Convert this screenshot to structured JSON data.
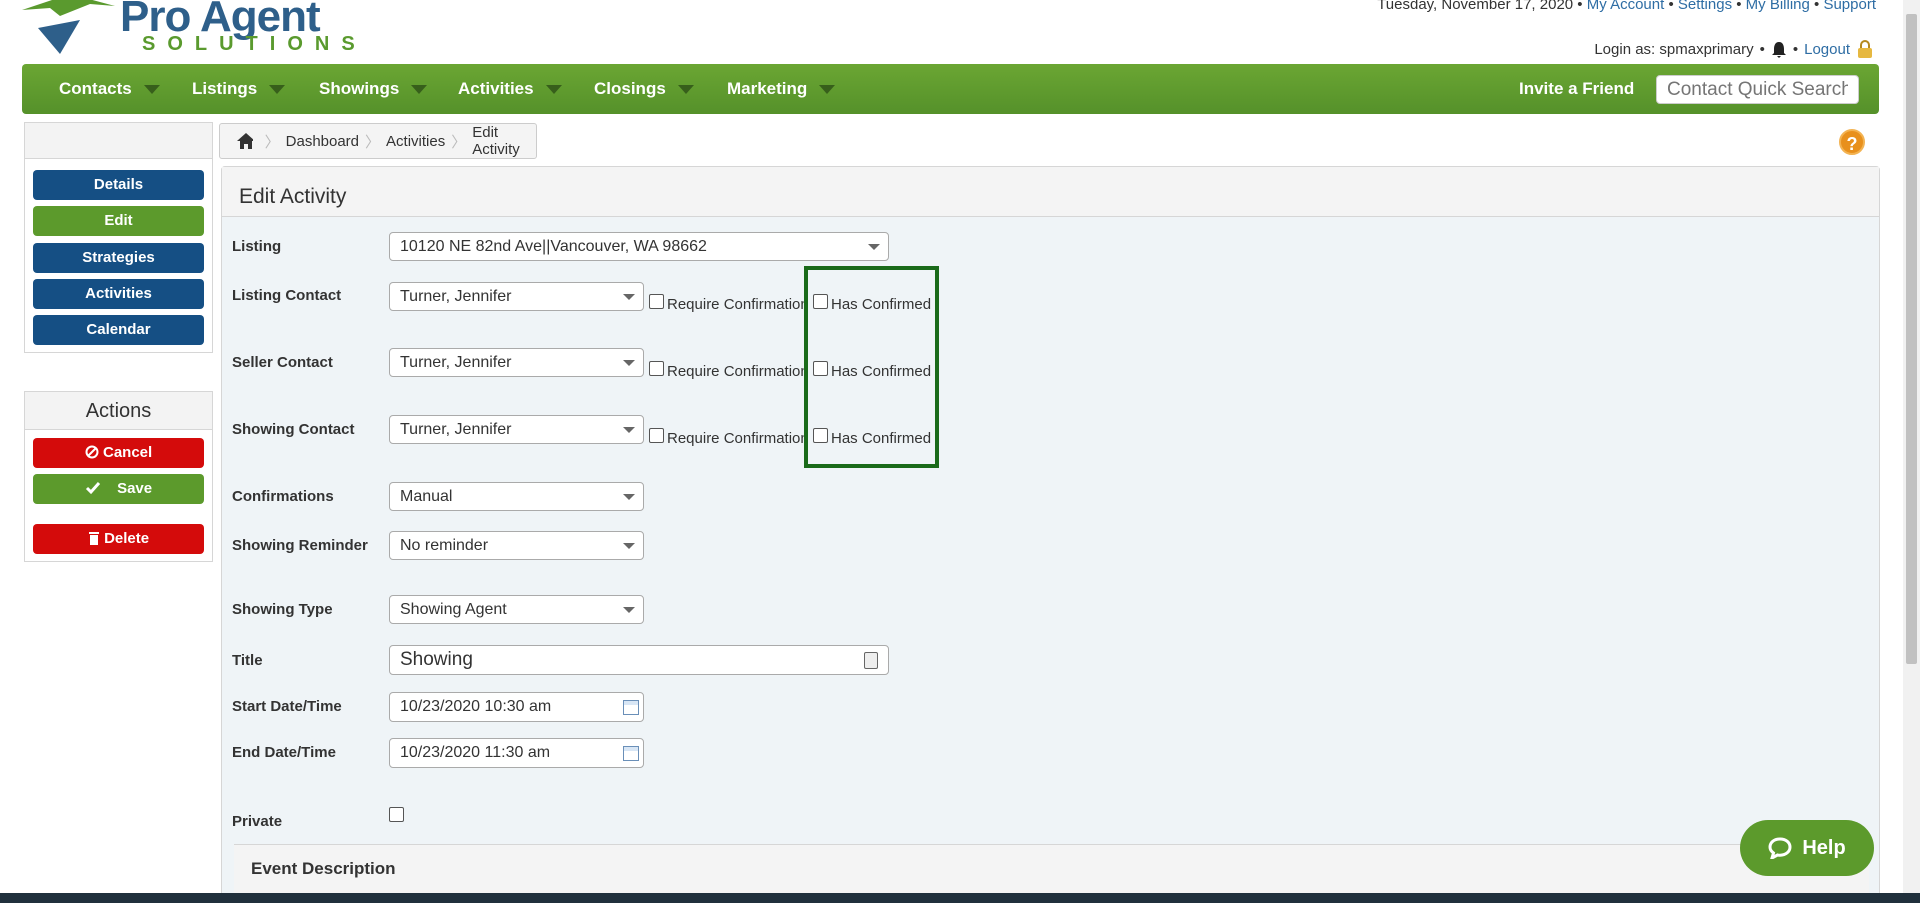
{
  "header": {
    "logo_top": "Pro Agent",
    "logo_bottom": "SOLUTIONS",
    "date": "Tuesday, November 17, 2020",
    "links": [
      "My Account",
      "Settings",
      "My Billing",
      "Support"
    ],
    "login_prefix": "Login as: spmaxprimary",
    "logout": "Logout"
  },
  "nav": {
    "items": [
      "Contacts",
      "Listings",
      "Showings",
      "Activities",
      "Closings",
      "Marketing"
    ],
    "invite": "Invite a Friend",
    "search_placeholder": "Contact Quick Search"
  },
  "sidebar": {
    "buttons": [
      "Details",
      "Edit",
      "Strategies",
      "Activities",
      "Calendar"
    ],
    "actions_title": "Actions",
    "cancel": "Cancel",
    "save": "Save",
    "delete": "Delete"
  },
  "breadcrumb": [
    "Dashboard",
    "Activities",
    "Edit Activity"
  ],
  "form": {
    "title": "Edit Activity",
    "listing_label": "Listing",
    "listing_value": "10120 NE 82nd Ave||Vancouver, WA 98662",
    "listing_contact_label": "Listing Contact",
    "listing_contact_value": "Turner, Jennifer",
    "seller_contact_label": "Seller Contact",
    "seller_contact_value": "Turner, Jennifer",
    "showing_contact_label": "Showing Contact",
    "showing_contact_value": "Turner, Jennifer",
    "require_confirmation": "Require Confirmation",
    "has_confirmed": "Has Confirmed",
    "confirmations_label": "Confirmations",
    "confirmations_value": "Manual",
    "reminder_label": "Showing Reminder",
    "reminder_value": "No reminder",
    "type_label": "Showing Type",
    "type_value": "Showing Agent",
    "title_label": "Title",
    "title_value": "Showing",
    "start_label": "Start Date/Time",
    "start_value": "10/23/2020 10:30 am",
    "end_label": "End Date/Time",
    "end_value": "10/23/2020 11:30 am",
    "private_label": "Private",
    "event_description": "Event Description"
  },
  "help": {
    "label": "Help",
    "question": "?"
  },
  "colors": {
    "nav_green": "#5c9a2c",
    "button_blue": "#154f84",
    "button_red": "#d40b0b",
    "highlight": "#1a6a1a"
  }
}
